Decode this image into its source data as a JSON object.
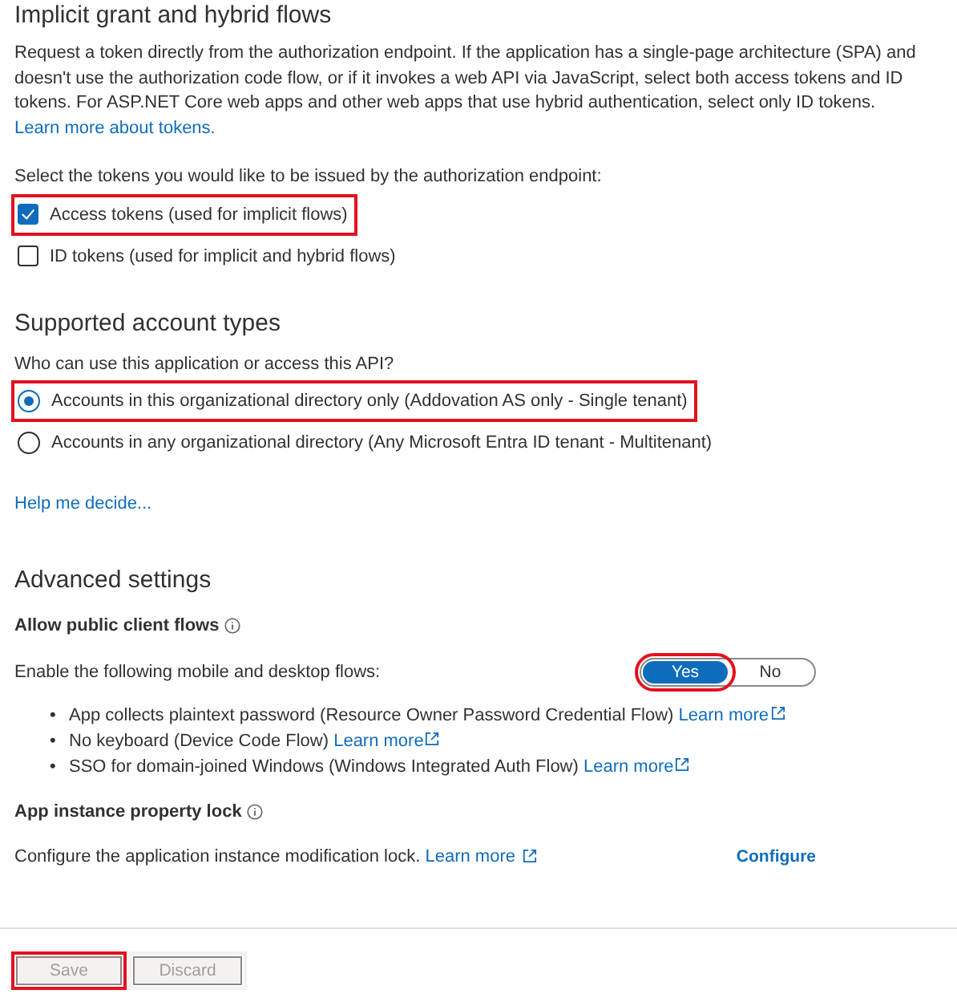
{
  "implicit": {
    "title": "Implicit grant and hybrid flows",
    "description": "Request a token directly from the authorization endpoint. If the application has a single-page architecture (SPA) and doesn't use the authorization code flow, or if it invokes a web API via JavaScript, select both access tokens and ID tokens. For ASP.NET Core web apps and other web apps that use hybrid authentication, select only ID tokens.",
    "link": "Learn more about tokens.",
    "prompt": "Select the tokens you would like to be issued by the authorization endpoint:",
    "tokens": [
      {
        "label": "Access tokens (used for implicit flows)",
        "checked": true,
        "highlighted": true
      },
      {
        "label": "ID tokens (used for implicit and hybrid flows)",
        "checked": false,
        "highlighted": false
      }
    ]
  },
  "accounts": {
    "title": "Supported account types",
    "question": "Who can use this application or access this API?",
    "options": [
      {
        "label": "Accounts in this organizational directory only (Addovation AS only - Single tenant)",
        "selected": true,
        "highlighted": true
      },
      {
        "label": "Accounts in any organizational directory (Any Microsoft Entra ID tenant - Multitenant)",
        "selected": false,
        "highlighted": false
      }
    ],
    "help": "Help me decide..."
  },
  "advanced": {
    "title": "Advanced settings",
    "public_flows": {
      "title": "Allow public client flows",
      "prompt": "Enable the following mobile and desktop flows:",
      "toggle": [
        {
          "label": "Yes",
          "selected": true,
          "highlighted": true
        },
        {
          "label": "No",
          "selected": false,
          "highlighted": false
        }
      ],
      "flows": [
        {
          "bullet": "•",
          "text": "App collects plaintext password (Resource Owner Password Credential Flow)",
          "link": "Learn more"
        },
        {
          "bullet": "•",
          "text": "No keyboard (Device Code Flow)",
          "link": "Learn more"
        },
        {
          "bullet": "•",
          "text": "SSO for domain-joined Windows (Windows Integrated Auth Flow)",
          "link": "Learn more"
        }
      ]
    },
    "lock": {
      "title": "App instance property lock",
      "text": "Configure the application instance modification lock.",
      "link": "Learn more",
      "action": "Configure"
    }
  },
  "footer": {
    "buttons": [
      {
        "label": "Save",
        "disabled": true,
        "highlighted": true
      },
      {
        "label": "Discard",
        "disabled": true,
        "highlighted": false
      }
    ]
  }
}
